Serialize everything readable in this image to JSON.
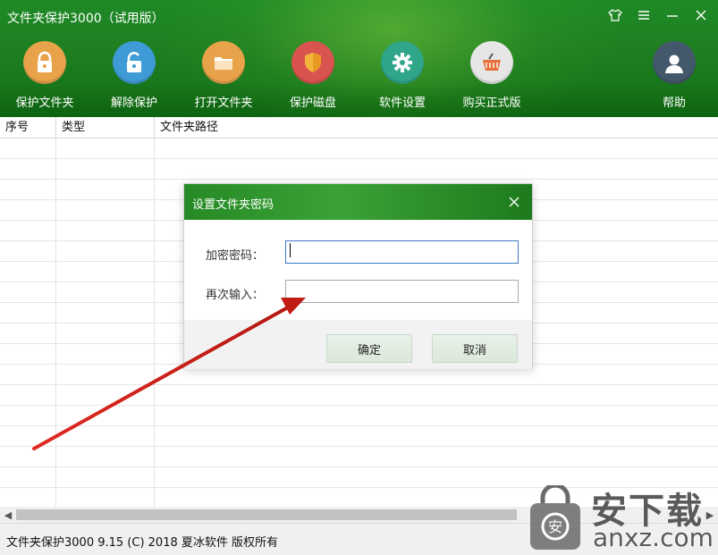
{
  "window": {
    "title": "文件夹保护3000（试用版）"
  },
  "window_controls": [
    "skin-icon",
    "menu-icon",
    "minimize-icon",
    "close-icon"
  ],
  "toolbar": {
    "items": [
      {
        "label": "保护文件夹",
        "icon": "lock-icon",
        "color": "#e8a24a"
      },
      {
        "label": "解除保护",
        "icon": "unlock-icon",
        "color": "#3f9bd6"
      },
      {
        "label": "打开文件夹",
        "icon": "folder-icon",
        "color": "#e8a24a"
      },
      {
        "label": "保护磁盘",
        "icon": "shield-icon",
        "color": "#d9534f"
      },
      {
        "label": "软件设置",
        "icon": "gear-icon",
        "color": "#2fa58a"
      },
      {
        "label": "购买正式版",
        "icon": "basket-icon",
        "color": "#e6e6e6"
      }
    ],
    "help": {
      "label": "帮助",
      "icon": "user-icon",
      "color": "#44586b"
    }
  },
  "table": {
    "columns": [
      "序号",
      "类型",
      "文件夹路径"
    ],
    "rows": []
  },
  "status": {
    "text": "文件夹保护3000 9.15 (C) 2018 夏冰软件 版权所有"
  },
  "dialog": {
    "title": "设置文件夹密码",
    "password_label": "加密密码：",
    "password_value": "",
    "confirm_label": "再次输入：",
    "confirm_value": "",
    "ok_label": "确定",
    "cancel_label": "取消"
  },
  "watermark": {
    "cn": "安下载",
    "en": "anxz.com"
  },
  "colors": {
    "header": "#1f7f22",
    "annotation_arrow": "#d9251d",
    "input_focus": "#3b7ac6"
  }
}
